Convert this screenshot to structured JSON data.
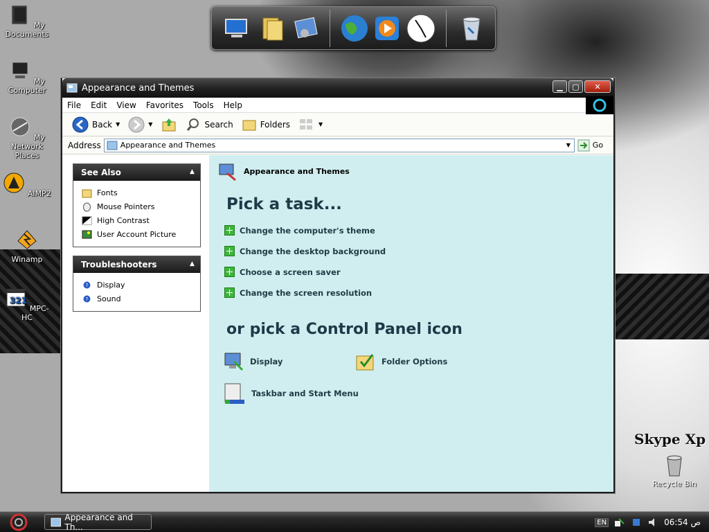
{
  "desktop": {
    "icons": [
      {
        "label": "My Documents",
        "icon": "my-documents-icon"
      },
      {
        "label": "My Computer",
        "icon": "my-computer-icon"
      },
      {
        "label": "My Network Places",
        "icon": "network-places-icon"
      },
      {
        "label": "AIMP2",
        "icon": "aimp-icon"
      },
      {
        "label": "Winamp",
        "icon": "winamp-icon"
      },
      {
        "label": "MPC-HC",
        "icon": "mpc-hc-icon"
      }
    ],
    "skype_label": "Skype Xp",
    "recycle_label": "Recycle Bin"
  },
  "dock": {
    "items": [
      "computer-icon",
      "folder-icon",
      "control-panel-icon",
      "globe-icon",
      "media-player-icon",
      "clock-icon",
      "trash-icon"
    ]
  },
  "window": {
    "title": "Appearance and Themes",
    "menu": [
      "File",
      "Edit",
      "View",
      "Favorites",
      "Tools",
      "Help"
    ],
    "toolbar": {
      "back": "Back",
      "search": "Search",
      "folders": "Folders"
    },
    "address": {
      "label": "Address",
      "value": "Appearance and Themes",
      "go": "Go"
    },
    "see_also": {
      "title": "See Also",
      "items": [
        {
          "label": "Fonts",
          "icon": "fonts-folder-icon"
        },
        {
          "label": "Mouse Pointers",
          "icon": "mouse-icon"
        },
        {
          "label": "High Contrast",
          "icon": "high-contrast-icon"
        },
        {
          "label": "User Account Picture",
          "icon": "picture-icon"
        }
      ]
    },
    "troubleshooters": {
      "title": "Troubleshooters",
      "items": [
        {
          "label": "Display",
          "icon": "help-icon"
        },
        {
          "label": "Sound",
          "icon": "help-icon"
        }
      ]
    },
    "main": {
      "heading": "Appearance and Themes",
      "pick_task": "Pick a task...",
      "tasks": [
        "Change the computer's theme",
        "Change the desktop background",
        "Choose a screen saver",
        "Change the screen resolution"
      ],
      "pick_icon": "or pick a Control Panel icon",
      "cp_icons": [
        {
          "label": "Display",
          "icon": "display-icon"
        },
        {
          "label": "Folder Options",
          "icon": "folder-options-icon"
        },
        {
          "label": "Taskbar and Start Menu",
          "icon": "taskbar-icon"
        }
      ]
    }
  },
  "taskbar": {
    "task_button": "Appearance and Th...",
    "lang": "EN",
    "clock": "06:54 ص"
  }
}
